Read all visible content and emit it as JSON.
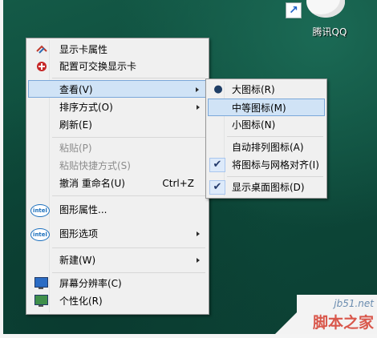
{
  "desktop": {
    "shortcut_label": "腾讯QQ"
  },
  "context_menu": {
    "items": [
      {
        "label": "显示卡属性",
        "icon": "graphics-properties-icon"
      },
      {
        "label": "配置可交换显示卡",
        "icon": "switchable-graphics-icon"
      },
      {
        "label": "查看(V)",
        "submenu": true,
        "highlighted": true
      },
      {
        "label": "排序方式(O)",
        "submenu": true
      },
      {
        "label": "刷新(E)"
      },
      {
        "label": "粘贴(P)",
        "disabled": true
      },
      {
        "label": "粘贴快捷方式(S)",
        "disabled": true
      },
      {
        "label": "撤消 重命名(U)",
        "shortcut": "Ctrl+Z"
      },
      {
        "label": "图形属性...",
        "icon": "intel-icon"
      },
      {
        "label": "图形选项",
        "icon": "intel-icon",
        "submenu": true
      },
      {
        "label": "新建(W)",
        "submenu": true
      },
      {
        "label": "屏幕分辨率(C)",
        "icon": "screen-resolution-icon"
      },
      {
        "label": "个性化(R)",
        "icon": "personalize-icon"
      }
    ]
  },
  "view_submenu": {
    "items": [
      {
        "label": "大图标(R)",
        "mark": "radio-bullet"
      },
      {
        "label": "中等图标(M)",
        "highlighted": true
      },
      {
        "label": "小图标(N)"
      },
      {
        "label": "自动排列图标(A)"
      },
      {
        "label": "将图标与网格对齐(I)",
        "mark": "checkmark"
      },
      {
        "label": "显示桌面图标(D)",
        "mark": "checkmark"
      }
    ]
  },
  "intel_icon_text": "intel",
  "watermark": {
    "site": "jb51.net",
    "name": "脚本之家"
  },
  "colors": {
    "desktop": "#0e4b3b",
    "menu_background": "#f0f0f0",
    "highlight": "#d0e3f6",
    "watermark_red": "#d9574b"
  }
}
